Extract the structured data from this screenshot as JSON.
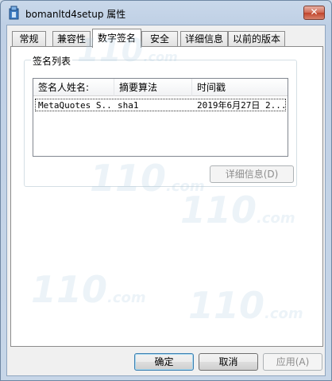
{
  "window": {
    "title": "bomanltd4setup 属性",
    "close_label": "✕"
  },
  "tabs": [
    {
      "label": "常规"
    },
    {
      "label": "兼容性"
    },
    {
      "label": "数字签名",
      "active": true
    },
    {
      "label": "安全"
    },
    {
      "label": "详细信息"
    },
    {
      "label": "以前的版本"
    }
  ],
  "signature_list": {
    "group_label": "签名列表",
    "columns": [
      "签名人姓名:",
      "摘要算法",
      "时间戳"
    ],
    "rows": [
      {
        "signer": "MetaQuotes S...",
        "digest": "sha1",
        "timestamp": "2019年6月27日 2..."
      }
    ],
    "details_button": "详细信息(D)"
  },
  "footer": {
    "ok": "确定",
    "cancel": "取消",
    "apply": "应用(A)"
  },
  "watermark": {
    "brand": "110",
    "domain": ".com"
  },
  "colors": {
    "accent": "#3c7fb1",
    "close": "#c0432b"
  }
}
